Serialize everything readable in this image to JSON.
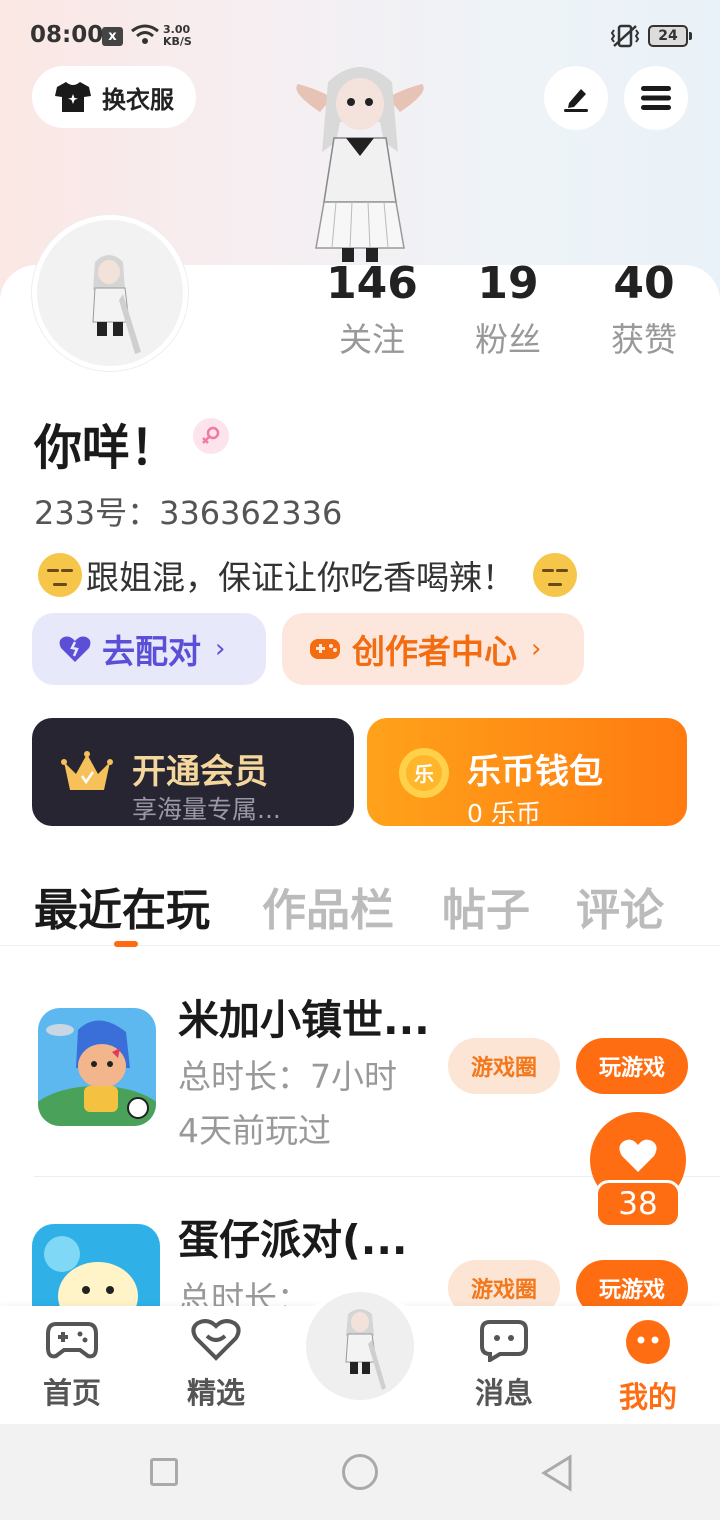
{
  "status_bar": {
    "time": "08:00",
    "notif_glyph": "x",
    "speed_value": "3.00",
    "speed_unit": "KB/S",
    "battery": "24"
  },
  "header": {
    "outfit_label": "换衣服",
    "outfit_icon": "tshirt-icon",
    "edit_icon": "pen-icon",
    "menu_icon": "menu-icon"
  },
  "stats": [
    {
      "value": "146",
      "label": "关注"
    },
    {
      "value": "19",
      "label": "粉丝"
    },
    {
      "value": "40",
      "label": "获赞"
    }
  ],
  "profile": {
    "nickname": "你咩！",
    "gender": "female",
    "uid": "233号：336362336",
    "bio": "跟姐混，保证让你吃香喝辣！"
  },
  "quick_links": {
    "pair_label": "去配对",
    "creator_label": "创作者中心"
  },
  "vip": {
    "title": "开通会员",
    "subtitle": "享海量专属..."
  },
  "wallet": {
    "title": "乐币钱包",
    "subtitle": "0 乐币",
    "coin_glyph": "乐"
  },
  "tabs": [
    "最近在玩",
    "作品栏",
    "帖子",
    "评论"
  ],
  "games": [
    {
      "title": "米加小镇世...",
      "duration": "总时长：7小时",
      "last_played": "4天前玩过",
      "circle_label": "游戏圈",
      "play_label": "玩游戏"
    },
    {
      "title": "蛋仔派对(...",
      "duration": "总时长：",
      "last_played": "",
      "circle_label": "游戏圈",
      "play_label": "玩游戏"
    }
  ],
  "like_count": "38",
  "bottom_nav": [
    {
      "label": "首页",
      "icon": "gamepad-icon"
    },
    {
      "label": "精选",
      "icon": "heart-chat-icon"
    },
    {
      "label": "消息",
      "icon": "message-icon"
    },
    {
      "label": "我的",
      "icon": "face-icon",
      "active": true
    }
  ],
  "colors": {
    "accent": "#ff6d12",
    "pair": "#5b4fd8",
    "vip_gold": "#f4d79c"
  }
}
